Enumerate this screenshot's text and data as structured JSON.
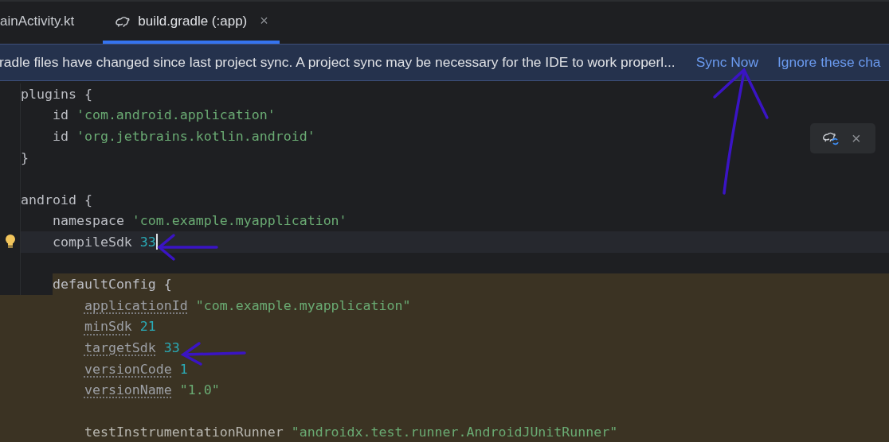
{
  "tabs": [
    {
      "label": "ainActivity.kt",
      "kind": "plain",
      "selected": false
    },
    {
      "label": "build.gradle (:app)",
      "kind": "gradle",
      "selected": true,
      "close": "×"
    }
  ],
  "banner": {
    "message": "radle files have changed since last project sync. A project sync may be necessary for the IDE to work properl...",
    "actions": [
      "Sync Now",
      "Ignore these cha"
    ]
  },
  "popup": {
    "close": "×"
  },
  "lines": [
    {
      "highlighted": false,
      "current": false,
      "bulb": false,
      "tokens": [
        {
          "kind": "plain",
          "text": "plugins {"
        }
      ],
      "children": [
        {
          "highlighted": false,
          "current": false,
          "bulb": false,
          "tokens": [
            {
              "kind": "plain",
              "text": "id"
            },
            {
              "kind": "string",
              "text": "'com.android.application'"
            }
          ]
        },
        {
          "highlighted": false,
          "current": false,
          "bulb": false,
          "tokens": [
            {
              "kind": "plain",
              "text": "id"
            },
            {
              "kind": "string",
              "text": "'org.jetbrains.kotlin.android'"
            }
          ]
        }
      ]
    },
    {
      "highlighted": false,
      "current": false,
      "bulb": false,
      "tokens": [
        {
          "kind": "plain",
          "text": "}"
        }
      ]
    },
    {
      "highlighted": false,
      "current": false,
      "bulb": false
    },
    {
      "highlighted": false,
      "current": false,
      "bulb": false,
      "tokens": [
        {
          "kind": "plain",
          "text": "android {"
        }
      ],
      "children": [
        {
          "highlighted": false,
          "current": false,
          "bulb": false,
          "tokens": [
            {
              "kind": "plain",
              "text": "namespace"
            },
            {
              "kind": "string",
              "text": "'com.example.myapplication'"
            }
          ]
        },
        {
          "highlighted": false,
          "current": true,
          "bulb": true,
          "tokens": [
            {
              "kind": "plain",
              "text": "compileSdk"
            },
            {
              "kind": "number",
              "text": "33"
            }
          ]
        },
        {
          "highlighted": false,
          "current": false,
          "bulb": false
        },
        {
          "highlighted": true,
          "current": false,
          "bulb": false,
          "tokens": [
            {
              "kind": "plain",
              "text": "defaultConfig {"
            }
          ],
          "children": [
            {
              "highlighted": true,
              "current": false,
              "bulb": false,
              "tokens": [
                {
                  "kind": "prop",
                  "text": "applicationId"
                },
                {
                  "kind": "string",
                  "text": "\"com.example.myapplication\""
                }
              ]
            },
            {
              "highlighted": true,
              "current": false,
              "bulb": false,
              "tokens": [
                {
                  "kind": "prop",
                  "text": "minSdk"
                },
                {
                  "kind": "number",
                  "text": "21"
                }
              ]
            },
            {
              "highlighted": true,
              "current": false,
              "bulb": false,
              "tokens": [
                {
                  "kind": "prop",
                  "text": "targetSdk"
                },
                {
                  "kind": "number",
                  "text": "33"
                }
              ]
            },
            {
              "highlighted": true,
              "current": false,
              "bulb": false,
              "tokens": [
                {
                  "kind": "prop",
                  "text": "versionCode"
                },
                {
                  "kind": "number",
                  "text": "1"
                }
              ]
            },
            {
              "highlighted": true,
              "current": false,
              "bulb": false,
              "tokens": [
                {
                  "kind": "prop",
                  "text": "versionName"
                },
                {
                  "kind": "string",
                  "text": "\"1.0\""
                }
              ]
            },
            {
              "highlighted": true,
              "current": false,
              "bulb": false
            },
            {
              "highlighted": true,
              "current": false,
              "bulb": false,
              "tokens": [
                {
                  "kind": "plain",
                  "text": "testInstrumentationRunner"
                },
                {
                  "kind": "string",
                  "text": "\"androidx.test.runner.AndroidJUnitRunner\""
                }
              ]
            }
          ]
        }
      ]
    }
  ]
}
